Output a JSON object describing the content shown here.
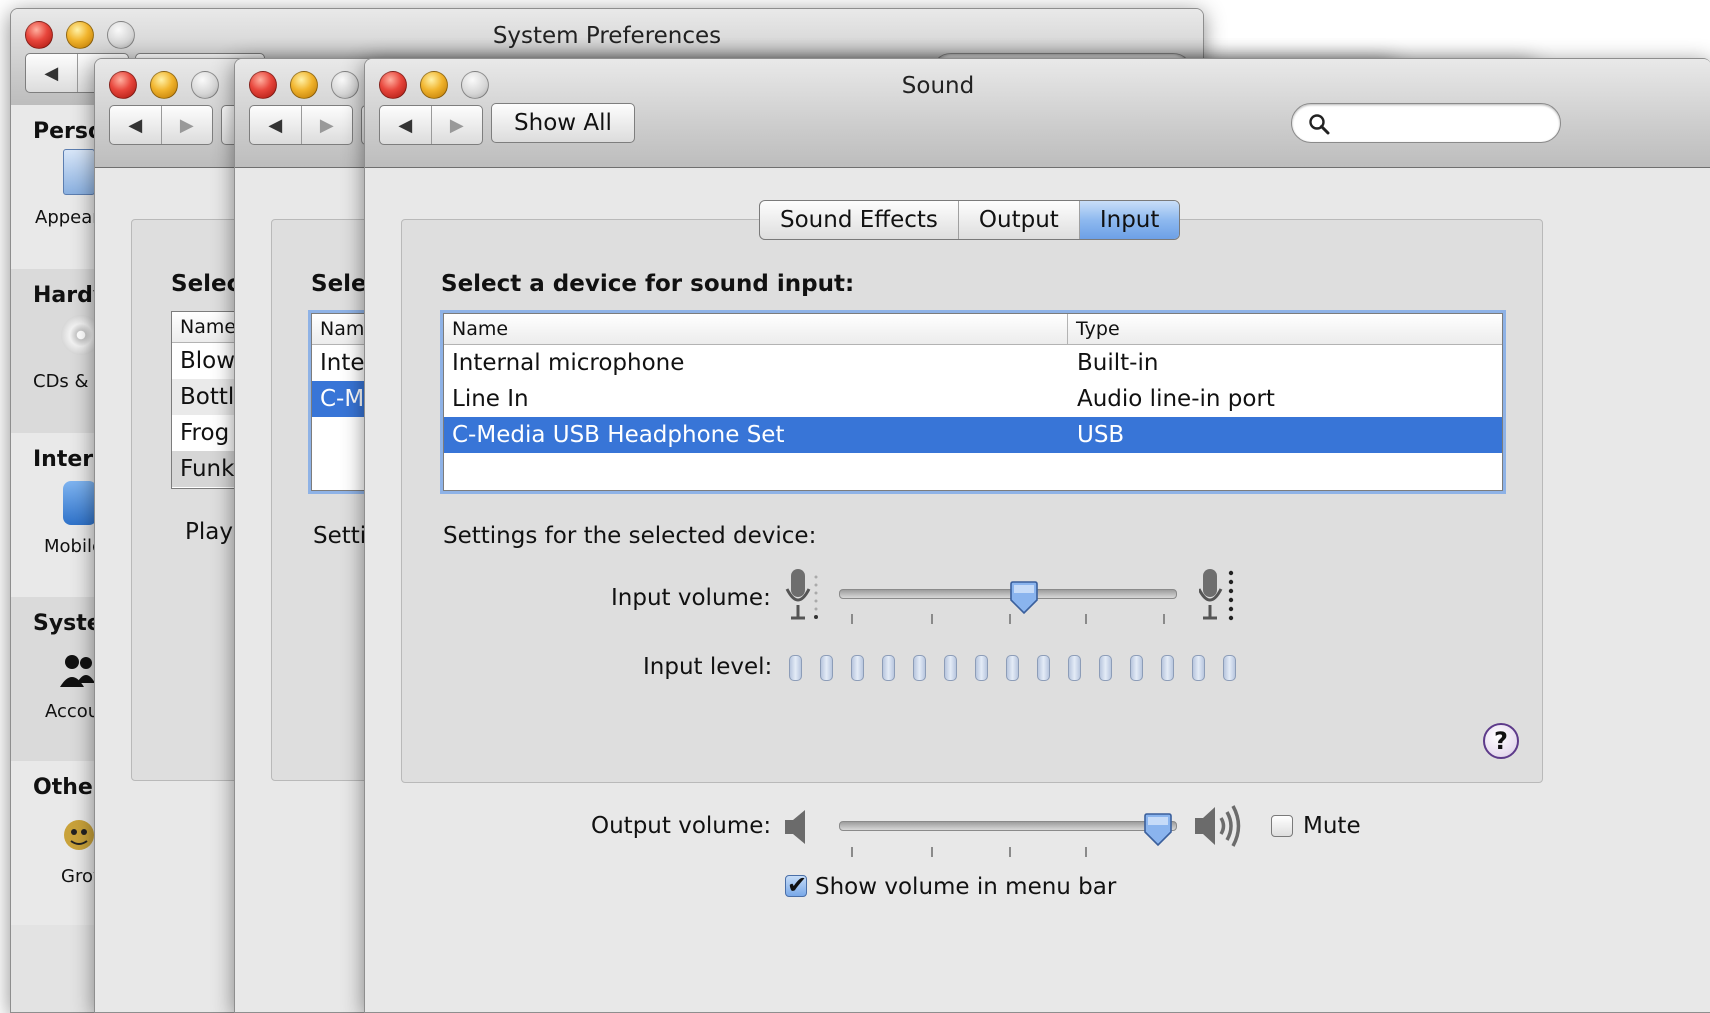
{
  "window1": {
    "title": "System Preferences",
    "categories": [
      "Perso",
      "Hardv",
      "Interr",
      "Syster",
      "Other"
    ],
    "items": [
      "Appear",
      "CDs & I",
      "Mobile",
      "Accou",
      "Grov"
    ]
  },
  "window2": {
    "section_head": "Select",
    "table_header": "Name",
    "rows": [
      "Blow",
      "Bottl",
      "Frog",
      "Funk"
    ],
    "play_label": "Play"
  },
  "window3": {
    "section_head": "Selec",
    "table_header": "Nam",
    "rows": [
      "Inter",
      "C-M"
    ],
    "settings_label": "Setti"
  },
  "sound": {
    "title": "Sound",
    "show_all": "Show All",
    "search_placeholder": "",
    "tabs": [
      {
        "label": "Sound Effects",
        "active": false
      },
      {
        "label": "Output",
        "active": false
      },
      {
        "label": "Input",
        "active": true
      }
    ],
    "select_heading": "Select a device for sound input:",
    "table": {
      "columns": [
        "Name",
        "Type"
      ],
      "rows": [
        {
          "name": "Internal microphone",
          "type": "Built-in",
          "selected": false
        },
        {
          "name": "Line In",
          "type": "Audio line-in port",
          "selected": false
        },
        {
          "name": "C-Media USB Headphone Set",
          "type": "USB",
          "selected": true
        }
      ]
    },
    "settings_heading": "Settings for the selected device:",
    "input_volume_label": "Input volume:",
    "input_volume_value": 0.55,
    "input_level_label": "Input level:",
    "input_level_segments": 15,
    "input_level_value": 0,
    "output_volume_label": "Output volume:",
    "output_volume_value": 0.95,
    "mute_label": "Mute",
    "mute_checked": false,
    "show_volume_label": "Show volume in menu bar",
    "show_volume_checked": true,
    "help": "?",
    "colors": {
      "selection": "#3875d7",
      "tab_active": "#8eb9ef",
      "focus_ring": "#8eb2e6"
    }
  }
}
